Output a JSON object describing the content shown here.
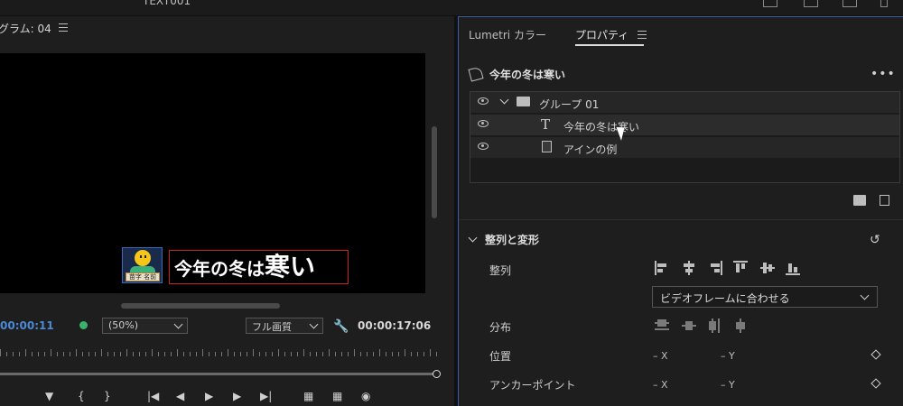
{
  "window": {
    "title": "TEXT001"
  },
  "program_monitor": {
    "title": "グラム: 04",
    "video_caption_main": "今年の冬は",
    "video_caption_big": "寒い",
    "avatar_tag": "苗字 名前",
    "timecode_current": "00:00:11",
    "zoom_value": "(50%)",
    "quality_value": "フル画質",
    "timecode_total": "00:00:17:06",
    "transport": [
      "marker-icon",
      "in-point-icon",
      "out-point-icon",
      "go-to-in-icon",
      "step-back-icon",
      "play-icon",
      "step-forward-icon",
      "go-to-out-icon",
      "insert-icon",
      "overwrite-icon",
      "camera-icon"
    ],
    "colors": {
      "timecode_current": "#4a8ad8",
      "caption_border": "#c9231f",
      "accent_border": "#3a5fa8"
    }
  },
  "tabs": [
    {
      "label": "Lumetri カラー"
    },
    {
      "label": "プロパティ"
    }
  ],
  "properties": {
    "header": "今年の冬は寒い",
    "layers": [
      {
        "label": "グループ 01",
        "kind": "group"
      },
      {
        "label": "今年の冬は寒い",
        "kind": "text"
      },
      {
        "label": "アインの例",
        "kind": "shape"
      }
    ],
    "section_title": "整列と変形",
    "align_label": "整列",
    "align_to_value": "ビデオフレームに合わせる",
    "distribute_label": "分布",
    "position_label": "位置",
    "anchor_label": "アンカーポイント",
    "x_label": "– X",
    "y_label": "– Y"
  }
}
